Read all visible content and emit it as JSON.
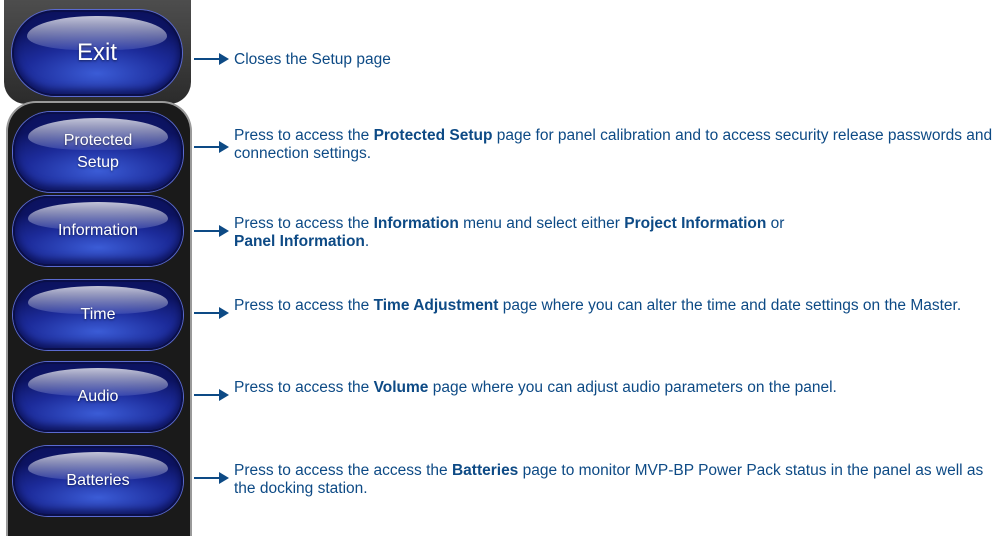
{
  "buttons": {
    "exit": "Exit",
    "protected_line1": "Protected",
    "protected_line2": "Setup",
    "information": "Information",
    "time": "Time",
    "audio": "Audio",
    "batteries": "Batteries"
  },
  "descriptions": {
    "exit": "Closes the Setup page",
    "protected": {
      "pre": "Press to access the ",
      "bold": "Protected Setup",
      "post": " page for panel calibration and to access security release passwords and connection settings."
    },
    "information": {
      "pre": "Press to access the ",
      "bold1": "Information",
      "mid1": " menu and select either ",
      "bold2": "Project Information",
      "mid2": " or ",
      "bold3": "Panel Information",
      "post": "."
    },
    "time": {
      "pre": "Press to access the ",
      "bold": "Time Adjustment",
      "post": " page where you can alter the time and date settings on the Master."
    },
    "audio": {
      "pre": "Press to access the ",
      "bold": "Volume",
      "post": " page where you can adjust audio parameters on the panel."
    },
    "batteries": {
      "pre": "Press to access the access the ",
      "bold": "Batteries",
      "post": " page to monitor MVP-BP Power Pack status in the panel as well as the docking station."
    }
  },
  "colors": {
    "text": "#0d4a85",
    "button": "#1c2b9a"
  }
}
